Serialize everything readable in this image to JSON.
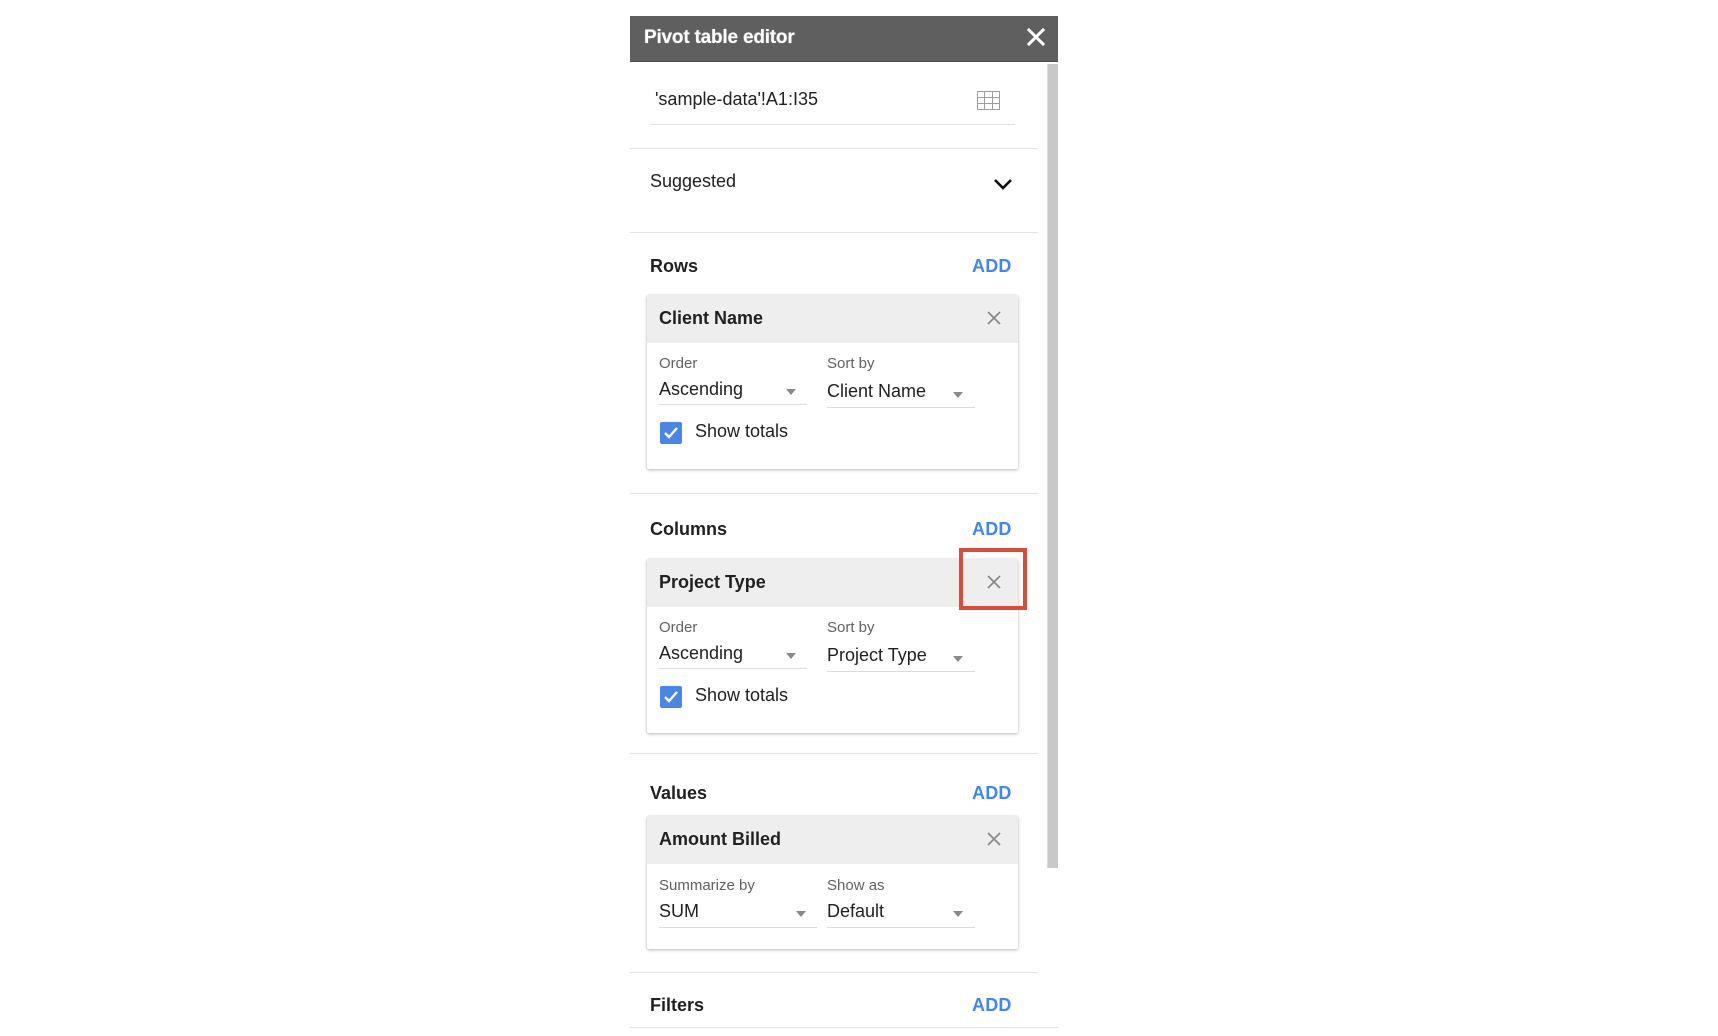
{
  "editor": {
    "title": "Pivot table editor",
    "range": "'sample-data'!A1:I35",
    "icons": {
      "close": "close-icon",
      "range_picker": "grid-icon",
      "suggested_toggle": "chevron-down-icon"
    }
  },
  "suggested": {
    "label": "Suggested"
  },
  "sections": {
    "rows": {
      "label": "Rows",
      "add_label": "ADD",
      "card": {
        "title": "Client Name",
        "left_field": {
          "label": "Order",
          "value": "Ascending"
        },
        "right_field": {
          "label": "Sort by",
          "value": "Client Name"
        },
        "show_totals": {
          "label": "Show totals",
          "checked": true
        }
      }
    },
    "columns": {
      "label": "Columns",
      "add_label": "ADD",
      "card": {
        "title": "Project Type",
        "left_field": {
          "label": "Order",
          "value": "Ascending"
        },
        "right_field": {
          "label": "Sort by",
          "value": "Project Type"
        },
        "show_totals": {
          "label": "Show totals",
          "checked": true
        },
        "remove_highlighted": true
      }
    },
    "values": {
      "label": "Values",
      "add_label": "ADD",
      "card": {
        "title": "Amount Billed",
        "left_field": {
          "label": "Summarize by",
          "value": "SUM"
        },
        "right_field": {
          "label": "Show as",
          "value": "Default"
        }
      }
    },
    "filters": {
      "label": "Filters",
      "add_label": "ADD"
    }
  },
  "colors": {
    "header_bg": "#5f5f5f",
    "accent_blue": "#4285f4",
    "checkbox_blue": "#4a86e8",
    "highlight_red": "#dc4a38",
    "card_header_bg": "#eeeeee"
  }
}
